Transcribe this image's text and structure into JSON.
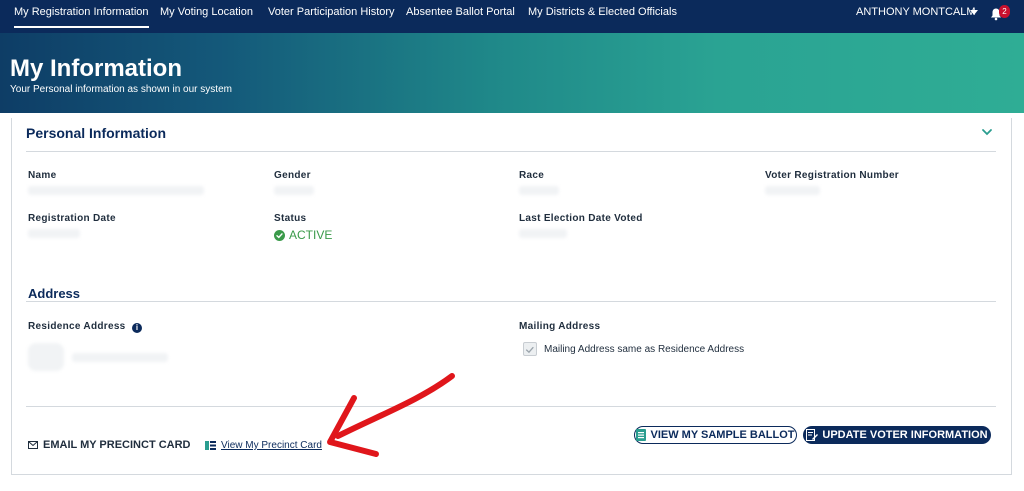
{
  "nav": {
    "items": [
      {
        "label": "My Registration Information",
        "active": true
      },
      {
        "label": "My Voting Location"
      },
      {
        "label": "Voter Participation History"
      },
      {
        "label": "Absentee Ballot Portal"
      },
      {
        "label": "My Districts & Elected Officials"
      }
    ],
    "user_name": "ANTHONY MONTCALM",
    "notification_count": "2"
  },
  "hero": {
    "title": "My Information",
    "subtitle": "Your Personal information as shown in our system"
  },
  "personal": {
    "title": "Personal Information",
    "labels": {
      "name": "Name",
      "gender": "Gender",
      "race": "Race",
      "voter_reg_number": "Voter Registration Number",
      "registration_date": "Registration Date",
      "status": "Status",
      "last_election": "Last Election Date Voted"
    },
    "status_value": "ACTIVE"
  },
  "address": {
    "title": "Address",
    "residence_label": "Residence Address",
    "mailing_label": "Mailing Address",
    "mailing_same_label": "Mailing Address same as Residence Address"
  },
  "actions": {
    "email_precinct": "EMAIL MY PRECINCT CARD",
    "view_precinct": "View My Precinct Card",
    "sample_ballot": "VIEW MY SAMPLE BALLOT",
    "update_info": "UPDATE VOTER INFORMATION"
  },
  "colors": {
    "navy": "#0b2a5b",
    "active_green": "#3a9a4a",
    "annotation_red": "#e0161b"
  }
}
